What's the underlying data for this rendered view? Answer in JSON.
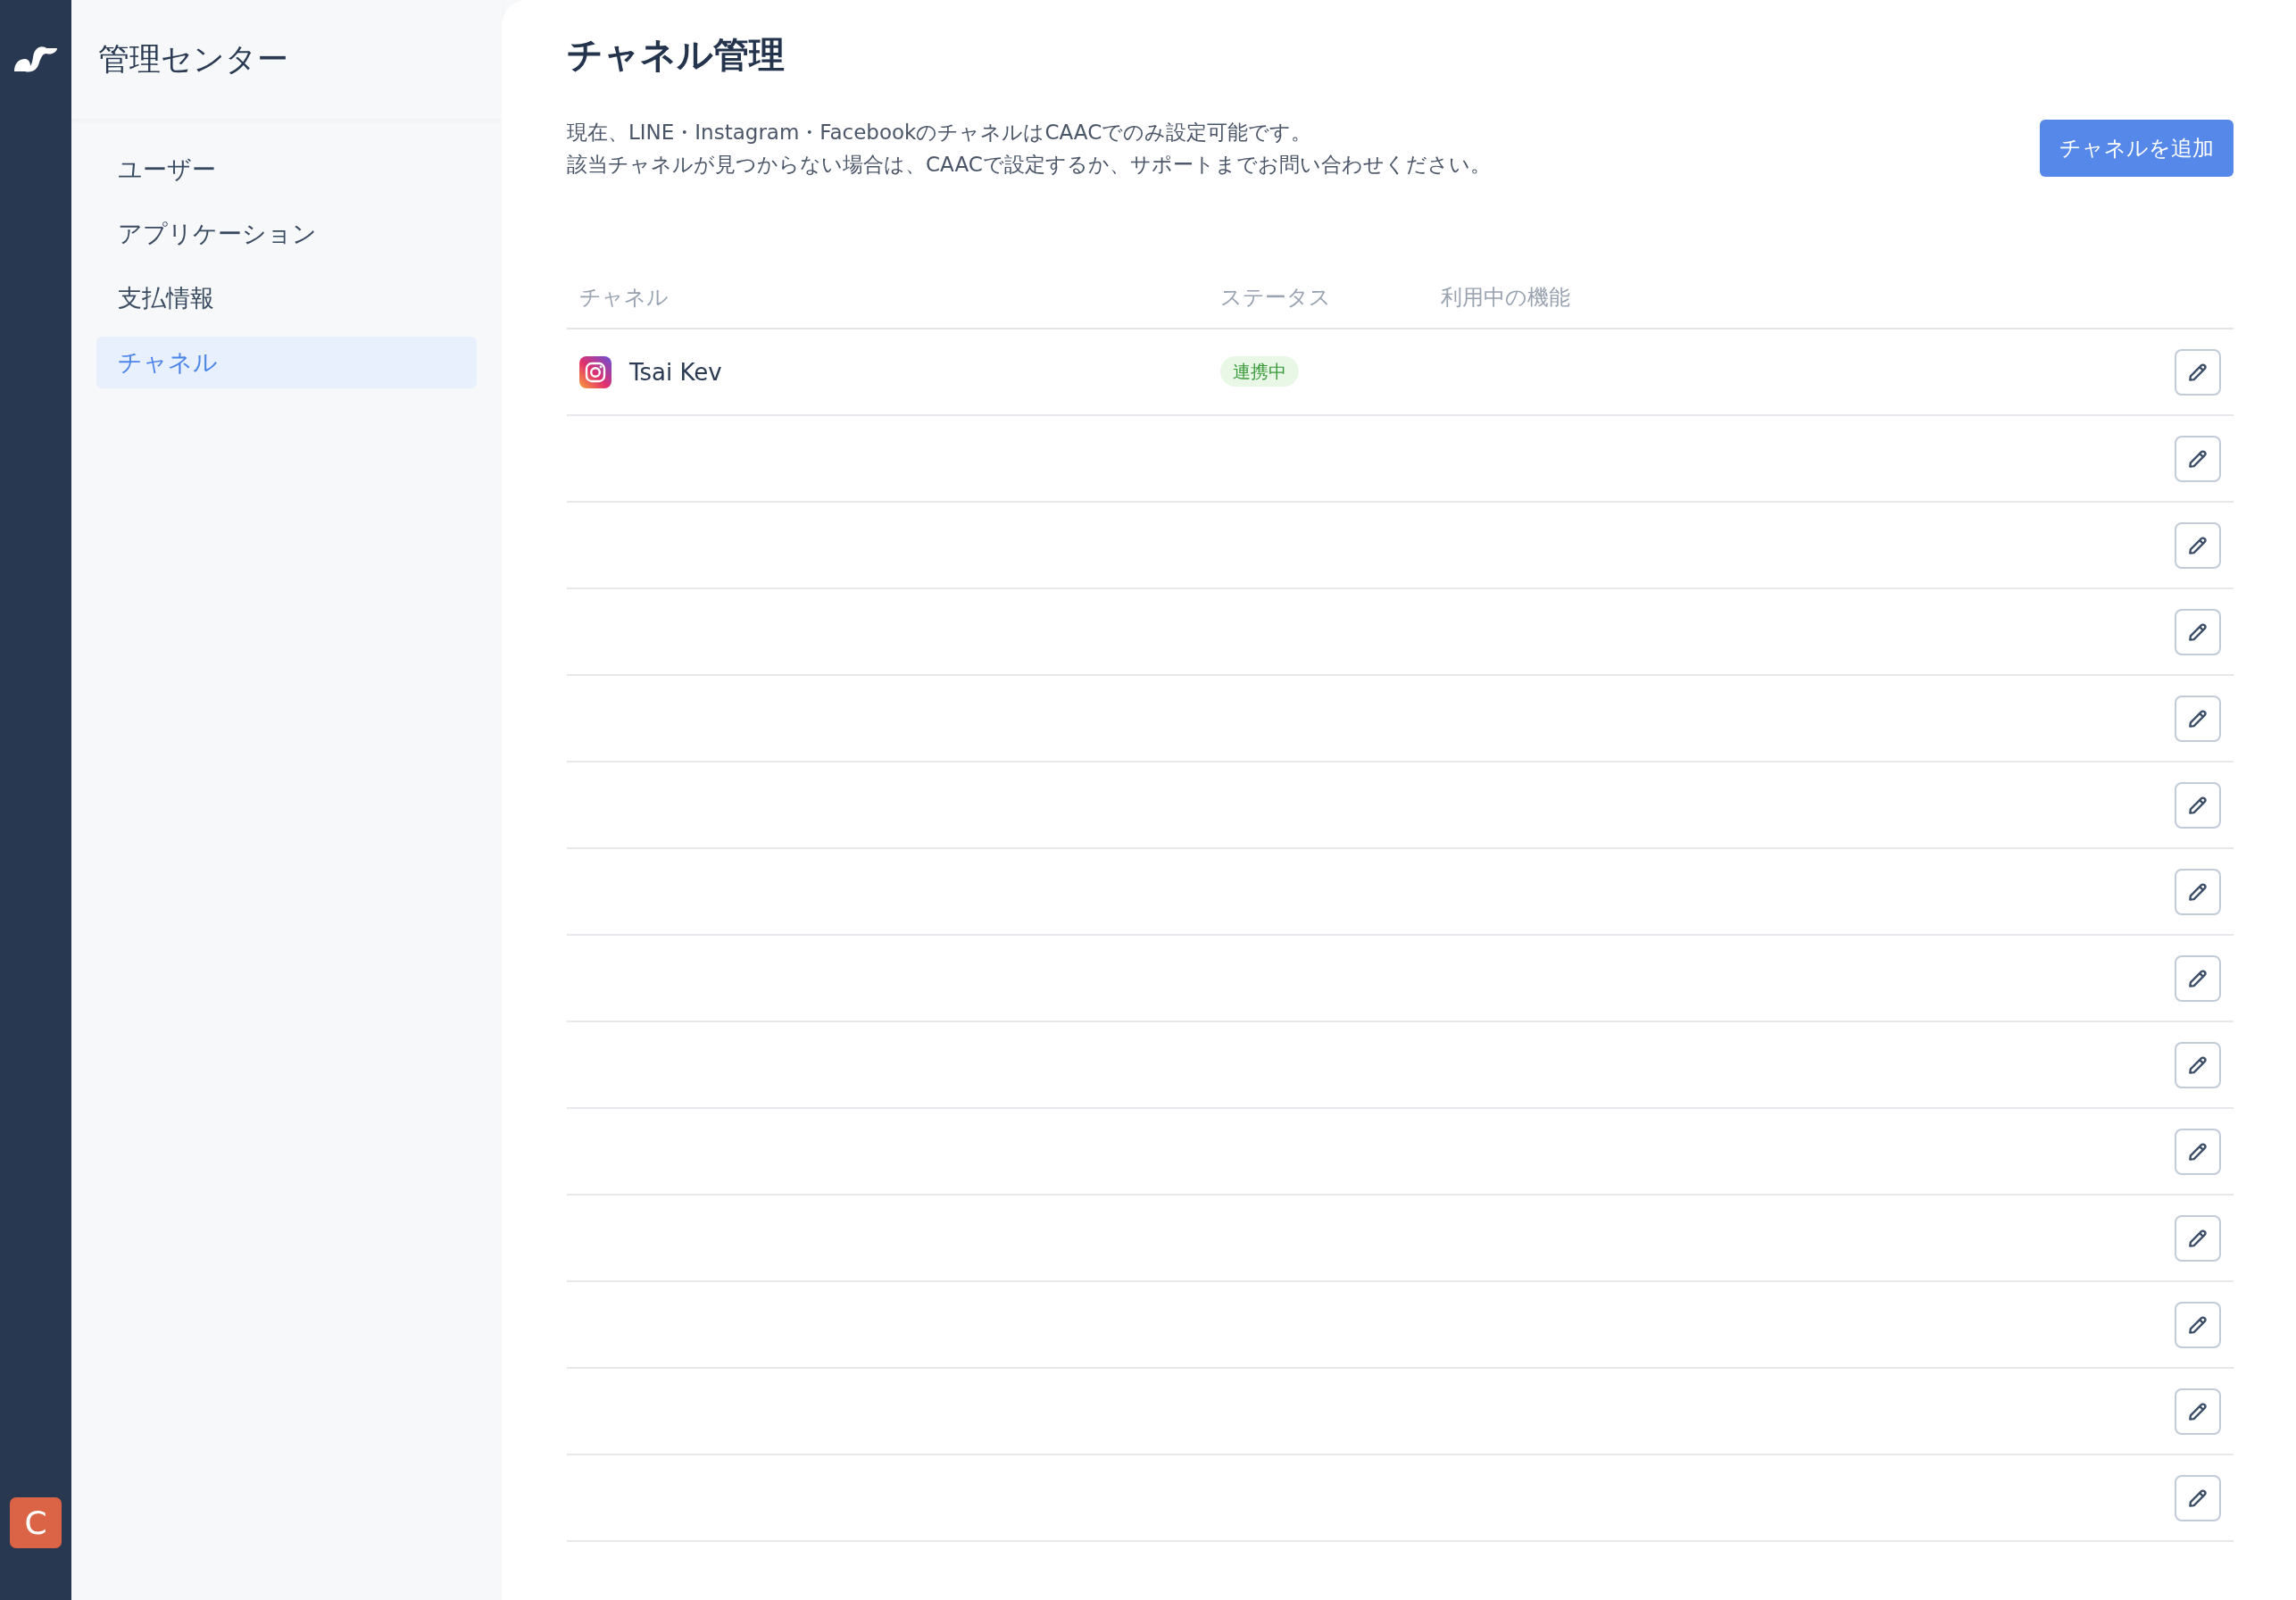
{
  "sidebar": {
    "title": "管理センター",
    "items": [
      {
        "label": "ユーザー",
        "selected": false
      },
      {
        "label": "アプリケーション",
        "selected": false
      },
      {
        "label": "支払情報",
        "selected": false
      },
      {
        "label": "チャネル",
        "selected": true
      }
    ]
  },
  "avatar": {
    "initial": "C"
  },
  "page": {
    "title": "チャネル管理",
    "notice": [
      "現在、LINE・Instagram・FacebookのチャネルはCAACでのみ設定可能です。",
      "該当チャネルが見つからない場合は、CAACで設定するか、サポートまでお問い合わせください。"
    ],
    "add_button": "チャネルを追加"
  },
  "table": {
    "columns": [
      "チャネル",
      "ステータス",
      "利用中の機能"
    ],
    "rows": [
      {
        "kind": "instagram",
        "channel": "Tsai Kev",
        "status": "連携中"
      },
      {
        "kind": "blank"
      },
      {
        "kind": "blank"
      },
      {
        "kind": "blank"
      },
      {
        "kind": "blank"
      },
      {
        "kind": "blank"
      },
      {
        "kind": "blank"
      },
      {
        "kind": "blank"
      },
      {
        "kind": "blank"
      },
      {
        "kind": "blank"
      },
      {
        "kind": "blank"
      },
      {
        "kind": "blank"
      },
      {
        "kind": "blank"
      },
      {
        "kind": "blank"
      }
    ]
  }
}
